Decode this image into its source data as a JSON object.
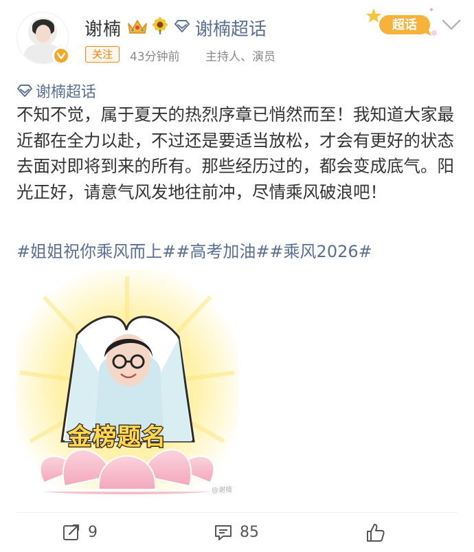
{
  "header": {
    "user_name": "谢楠",
    "topic_name": "谢楠超话",
    "follow_label": "关注",
    "time": "43分钟前",
    "role": "主持人、演员",
    "badge_text": "超话"
  },
  "post": {
    "topic": "谢楠超话",
    "body": "不知不觉，属于夏天的热烈序章已悄然而至！我知道大家最近都在全力以赴，不过还是要适当放松，才会有更好的状态去面对即将到来的所有。那些经历过的，都会变成底气。阳光正好，请意气风发地往前冲，尽情乘风破浪吧！",
    "hashtags": "#姐姐祝你乘风而上##高考加油##乘风2026#",
    "sticker_text": "金榜题名",
    "watermark": "@谢楠"
  },
  "actions": {
    "repost_count": "9",
    "comment_count": "85"
  },
  "colors": {
    "link": "#5a6f96",
    "accent": "#ff8200",
    "text": "#333333"
  },
  "icons": [
    "crown-icon",
    "sunflower-icon",
    "diamond-icon",
    "chevron-down-icon",
    "repost-icon",
    "comment-icon",
    "like-icon"
  ]
}
